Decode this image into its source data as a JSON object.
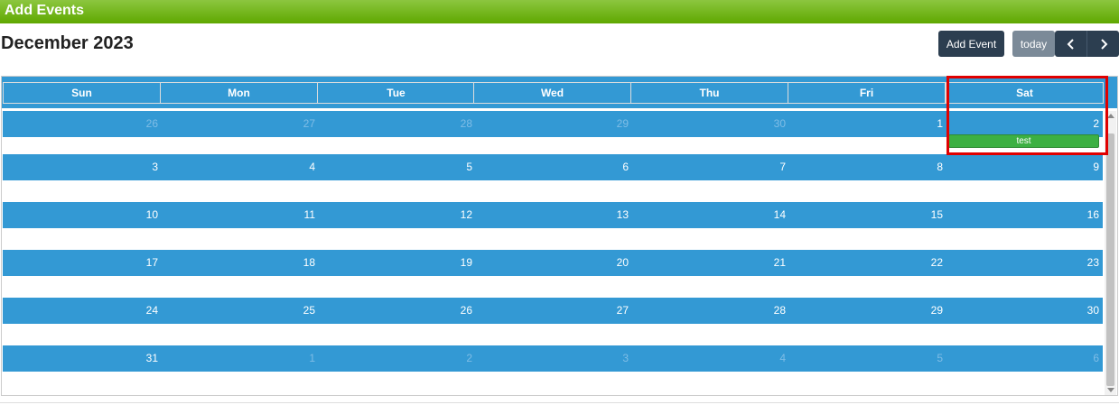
{
  "window": {
    "title": "Add Events"
  },
  "calendar": {
    "month_title": "December 2023",
    "buttons": {
      "add_event": "Add Event",
      "today": "today",
      "prev_icon": "chevron-left-icon",
      "next_icon": "chevron-right-icon"
    },
    "weekdays": [
      "Sun",
      "Mon",
      "Tue",
      "Wed",
      "Thu",
      "Fri",
      "Sat"
    ],
    "weeks": [
      [
        "26",
        "27",
        "28",
        "29",
        "30",
        "1",
        "2"
      ],
      [
        "3",
        "4",
        "5",
        "6",
        "7",
        "8",
        "9"
      ],
      [
        "10",
        "11",
        "12",
        "13",
        "14",
        "15",
        "16"
      ],
      [
        "17",
        "18",
        "19",
        "20",
        "21",
        "22",
        "23"
      ],
      [
        "24",
        "25",
        "26",
        "27",
        "28",
        "29",
        "30"
      ],
      [
        "31",
        "1",
        "2",
        "3",
        "4",
        "5",
        "6"
      ]
    ],
    "events": [
      {
        "title": "test",
        "date": "2"
      }
    ]
  },
  "colors": {
    "header_green": "#6cb800",
    "day_blue": "#3399d4",
    "event_green": "#3cb043",
    "button_dark": "#2c3e50",
    "highlight_red": "#e00000"
  }
}
